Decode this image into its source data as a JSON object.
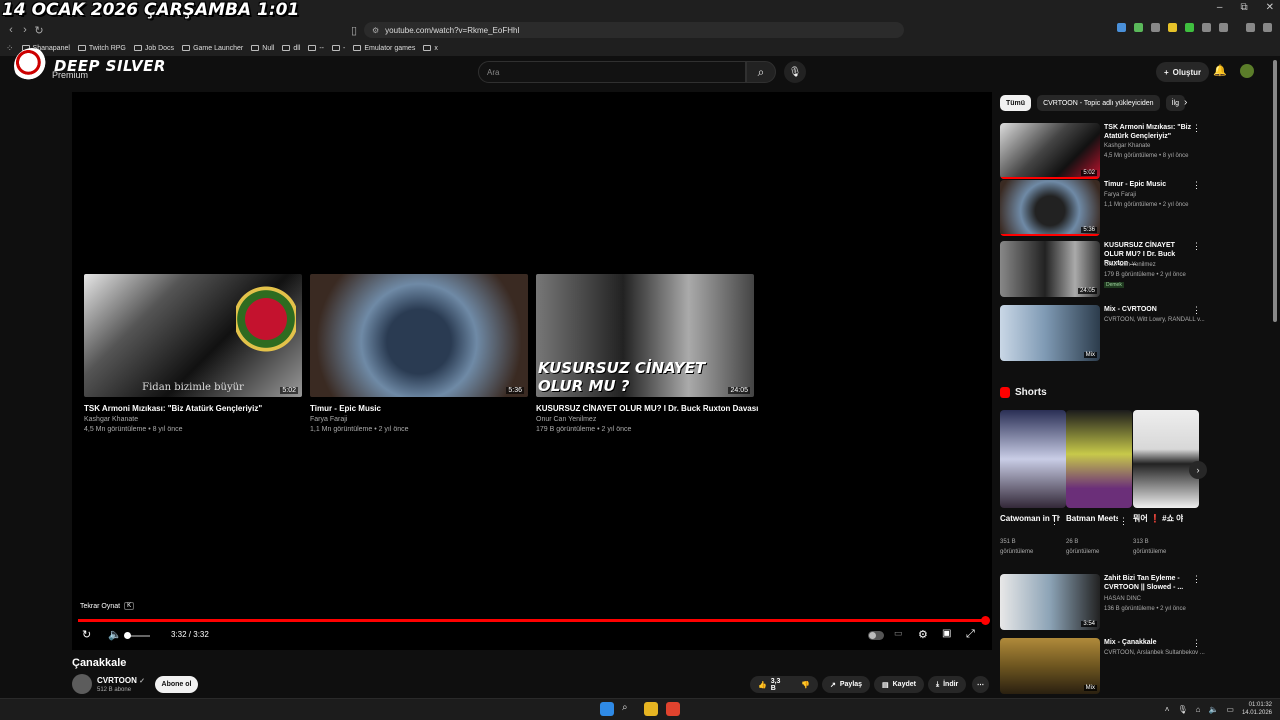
{
  "overlay": {
    "date_text": "14 OCAK 2026 ÇARŞAMBA 1:01"
  },
  "window": {
    "controls": [
      "–",
      "⧉",
      "✕"
    ]
  },
  "browser": {
    "url": "youtube.com/watch?v=Rkme_EoFHhI",
    "bookmarks": [
      "Shanapanel",
      "Twitch RPG",
      "Job Docs",
      "Game Launcher",
      "Null",
      "dll",
      "--",
      "-",
      "Emulator games",
      "x"
    ]
  },
  "header": {
    "logo_text": "DEEP SILVER",
    "premium_label": "Premium",
    "search_placeholder": "Ara",
    "create_label": "Oluştur"
  },
  "player": {
    "end_cards": [
      {
        "title": "TSK Armoni Mızıkası: \"Biz Atatürk Gençleriyiz\"",
        "channel": "Kashgar Khanate",
        "meta": "4,5 Mn görüntüleme • 8 yıl önce",
        "duration": "5:02",
        "overlay": "Fidan bizimle büyür"
      },
      {
        "title": "Timur - Epic Music",
        "channel": "Farya Faraji",
        "meta": "1,1 Mn görüntüleme • 2 yıl önce",
        "duration": "5:36",
        "overlay": ""
      },
      {
        "title": "KUSURSUZ CİNAYET OLUR MU? I Dr. Buck Ruxton Davası",
        "channel": "Onur Can Yenilmez",
        "meta": "179 B görüntüleme • 2 yıl önce",
        "duration": "24:05",
        "overlay": "KUSURSUZ CİNAYET OLUR MU ?"
      }
    ],
    "replay_label": "Tekrar Oynat",
    "replay_key": "K",
    "time": "3:32 / 3:32"
  },
  "video": {
    "title": "Çanakkale",
    "channel": "CVRTOON",
    "subscribers": "512 B abone",
    "subscribe_label": "Abone ol",
    "likes": "3,3 B",
    "share_label": "Paylaş",
    "save_label": "Kaydet",
    "download_label": "İndir"
  },
  "sidebar": {
    "chips": [
      "Tümü",
      "CVRTOON - Topic adlı yükleyiciden",
      "İlg"
    ],
    "recommendations": [
      {
        "title": "TSK Armoni Mızıkası: \"Biz Atatürk Gençleriyiz\"",
        "channel": "Kashgar Khanate",
        "meta": "4,5 Mn görüntüleme • 8 yıl önce",
        "duration": "5:02"
      },
      {
        "title": "Timur - Epic Music",
        "channel": "Farya Faraji",
        "meta": "1,1 Mn görüntüleme • 2 yıl önce",
        "duration": "5:36"
      },
      {
        "title": "KUSURSUZ CİNAYET OLUR MU? I Dr. Buck Ruxton ...",
        "channel": "Onur Can Yenilmez",
        "meta": "179 B görüntüleme • 2 yıl önce",
        "duration": "24:05",
        "badge": "Demek"
      },
      {
        "title": "Mix - CVRTOON",
        "channel": "CVRTOON, Witt Lowry, RANDALL v...",
        "meta": "",
        "duration": "Mix"
      }
    ],
    "shorts_title": "Shorts",
    "shorts": [
      {
        "title": "Catwoman in The Batcav...",
        "views": "351 B",
        "unit": "görüntüleme"
      },
      {
        "title": "Batman Meets The ...",
        "views": "26 B",
        "unit": "görüntüleme"
      },
      {
        "title": "뭐어 ❗ #쇼 야...",
        "views": "313 B",
        "unit": "görüntüleme"
      }
    ],
    "more_recommendations": [
      {
        "title": "Zahit Bizi Tan Eyleme - CVRTOON || Slowed - ...",
        "channel": "HASAN DINC",
        "meta": "136 B görüntüleme • 2 yıl önce",
        "duration": "3:54"
      },
      {
        "title": "Mix - Çanakkale",
        "channel": "CVRTOON, Arslanbek Sultanbekov ...",
        "meta": "",
        "duration": "Mix"
      }
    ]
  },
  "taskbar": {
    "time": "01:01:32",
    "date": "14.01.2026"
  },
  "colors": {
    "accent": "#ff0000",
    "background": "#0f0f0f"
  }
}
